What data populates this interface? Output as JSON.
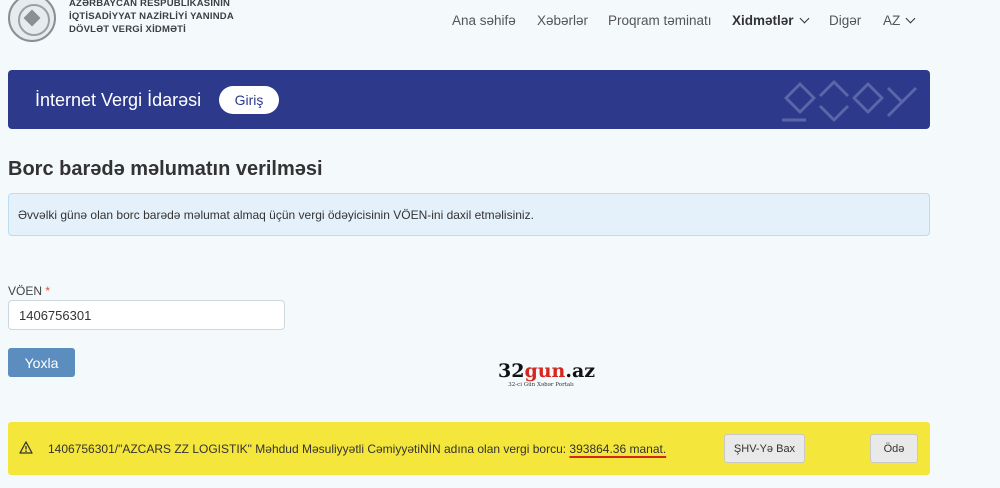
{
  "header": {
    "org_lines": [
      "AZƏRBAYCAN RESPUBLİKASININ",
      "İQTİSADİYYAT NAZİRLİYİ YANINDA",
      "DÖVLƏT VERGİ XİDMƏTİ"
    ],
    "nav": {
      "home": "Ana səhifə",
      "news": "Xəbərlər",
      "software": "Proqram təminatı",
      "services": "Xidmətlər",
      "other": "Digər",
      "lang": "AZ"
    }
  },
  "banner": {
    "title": "İnternet Vergi İdarəsi",
    "login_label": "Giriş",
    "bg_color": "#2d3a8c"
  },
  "main": {
    "page_title": "Borc barədə məlumatın verilməsi",
    "info_text": "Əvvəlki günə olan borc barədə məlumat almaq üçün vergi ödəyicisinin VÖEN-ini daxil etməlisiniz.",
    "voen_label": "VÖEN",
    "required_mark": "*",
    "voen_value": "1406756301",
    "check_label": "Yoxla",
    "check_color": "#5b8dbf"
  },
  "watermark": {
    "logo_prefix": "32",
    "logo_highlight": "gun",
    "logo_suffix": ".az",
    "subtitle": "32-ci Gün Xəbər Portalı"
  },
  "alert": {
    "icon": "warning-icon",
    "text_prefix": "1406756301/\"AZCARS ZZ LOGISTIK\" Məhdud Məsuliyyətli CəmiyyətiNİN adına olan vergi borcu: ",
    "debt_amount": "393864.36 manat.",
    "view_button": "ŞHV-Yə Bax",
    "pay_button": "Ödə",
    "bg_color": "#f5e63c"
  }
}
